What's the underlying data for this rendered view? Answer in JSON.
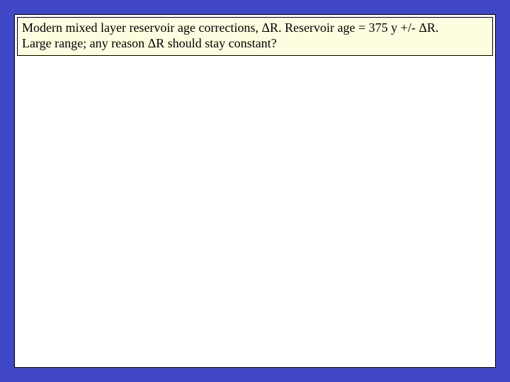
{
  "caption": {
    "line1": "Modern mixed layer reservoir age corrections, ΔR. Reservoir age = 375 y +/-  ΔR.",
    "line2": "Large range; any reason ΔR should stay constant?"
  }
}
